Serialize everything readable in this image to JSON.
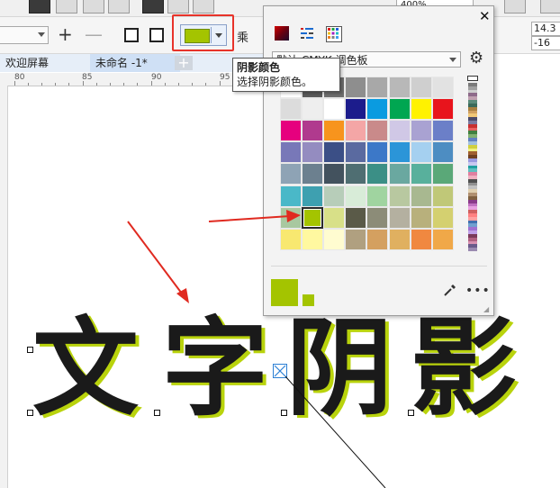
{
  "toolbar": {
    "zoom_value": "400%"
  },
  "property_bar": {
    "shadow_color": "#a4c400",
    "merge_mode_label": "乘",
    "field_1": "14.3",
    "field_2": "-16"
  },
  "tabs": [
    {
      "label": "欢迎屏幕"
    },
    {
      "label": "未命名 -1*"
    }
  ],
  "tab_add_label": "+",
  "ruler": {
    "labels": [
      "80",
      "85",
      "90",
      "95"
    ]
  },
  "tooltip": {
    "title": "阴影颜色",
    "description": "选择阴影颜色。"
  },
  "palette_popup": {
    "palette_name": "默认 CMYK 调色板",
    "selected_color": "#a4c400",
    "swatches": [
      [
        "#ffffff",
        "#5a5a5a",
        "#6e6e6e",
        "#8e8e8e",
        "#a8a8a8",
        "#b8b8b8",
        "#cfcfcf",
        "#e2e2e2"
      ],
      [
        "#dcdcdc",
        "#eeeeee",
        "#ffffff",
        "#1c1c8c",
        "#0a9be0",
        "#00a651",
        "#fff200",
        "#e8141c"
      ],
      [
        "#e6007e",
        "#b03a8e",
        "#f7941d",
        "#f4a6a6",
        "#c98a8a",
        "#d0c8e6",
        "#a9a2d2",
        "#6b7fc8"
      ],
      [
        "#7878b8",
        "#948cc0",
        "#3b4f86",
        "#5a6aa0",
        "#3c78c8",
        "#2b95d8",
        "#a5d0f0",
        "#4d8dc2"
      ],
      [
        "#8ea3b5",
        "#6c808f",
        "#43525e",
        "#4f6e72",
        "#3b8f86",
        "#6aa8a0",
        "#58b09c",
        "#5aa878"
      ],
      [
        "#4ab8c8",
        "#3ea0b0",
        "#b7cdb9",
        "#d8ecd8",
        "#a0d4a0",
        "#b8c8a0",
        "#a8b890",
        "#c0c878"
      ],
      [
        "#a8c8a0",
        "#a4c400",
        "#d8e088",
        "#5a5a48",
        "#8c8c78",
        "#b4b0a0",
        "#b8b07c",
        "#d4d070"
      ],
      [
        "#f8e870",
        "#fff8a0",
        "#fffcd0",
        "#b0a080",
        "#d4a060",
        "#e0b060",
        "#f08840",
        "#f0a848"
      ]
    ],
    "strip_colors": [
      "#7a7a7a",
      "#a0a0a0",
      "#cfcfcf",
      "#8e6a8a",
      "#c0a0b0",
      "#5a8a7a",
      "#3a6a5a",
      "#a88040",
      "#d0a060",
      "#f0c878",
      "#4a4a6a",
      "#7a7aa0",
      "#c83030",
      "#e86060",
      "#408040",
      "#80b070",
      "#6080c0",
      "#a0c0e0",
      "#d0d040",
      "#f0f080",
      "#a06030",
      "#704020",
      "#9a9ae0",
      "#c8c8f0",
      "#20a0a0",
      "#60c0c0",
      "#e080a0",
      "#f0b0c0",
      "#505050",
      "#909090",
      "#c0c0c0",
      "#e0d0b0",
      "#b09070",
      "#806040",
      "#8a3a8a",
      "#c070c0",
      "#e8a0e0",
      "#d06060",
      "#ff8080",
      "#ffa0a0",
      "#4070b0",
      "#70a0d0",
      "#a070d0",
      "#c0a0e8",
      "#7a3a5a",
      "#b06080",
      "#d890b0",
      "#6a5a8a",
      "#9a8ab0"
    ]
  },
  "canvas": {
    "characters": [
      "文",
      "字",
      "阴",
      "影"
    ]
  },
  "icons": {
    "close": "close-icon",
    "gear": "gear-icon",
    "eyedropper": "eyedropper-icon",
    "more": "more-options-icon"
  }
}
